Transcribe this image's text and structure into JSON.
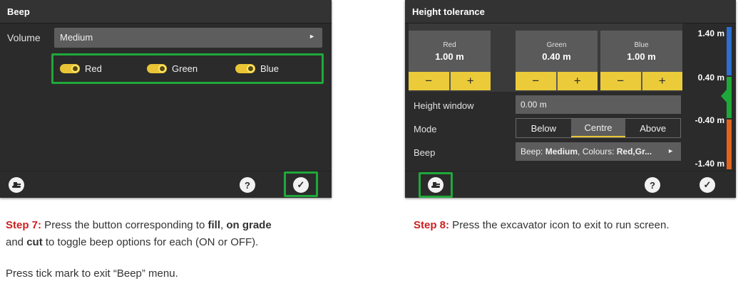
{
  "screen1": {
    "title": "Beep",
    "volume_label": "Volume",
    "volume_value": "Medium",
    "toggles": [
      {
        "label": "Red",
        "state": "on"
      },
      {
        "label": "Green",
        "state": "on"
      },
      {
        "label": "Blue",
        "state": "on"
      }
    ]
  },
  "screen2": {
    "title": "Height tolerance",
    "cards": [
      {
        "name": "Red",
        "value": "1.00 m",
        "minus": "−",
        "plus": "+"
      },
      {
        "name": "Green",
        "value": "0.40 m",
        "minus": "−",
        "plus": "+"
      },
      {
        "name": "Blue",
        "value": "1.00 m",
        "minus": "−",
        "plus": "+"
      }
    ],
    "height_window_label": "Height window",
    "height_window_value": "0.00 m",
    "mode_label": "Mode",
    "mode_options": [
      "Below",
      "Centre",
      "Above"
    ],
    "mode_selected": "Centre",
    "beep_label": "Beep",
    "beep_summary": {
      "prefix": "Beep: ",
      "volume": "Medium",
      "mid": ", Colours: ",
      "colours": "Red,Gr..."
    },
    "scale_labels": [
      "1.40 m",
      "0.40 m",
      "-0.40 m",
      "-1.40 m"
    ]
  },
  "icons": {
    "excavator": "excavator-icon",
    "help": "?",
    "confirm": "✓",
    "dropdown_arrow": "►"
  },
  "captions": {
    "step7": {
      "step": "Step 7:",
      "line1_a": " Press the button corresponding to ",
      "line1_b1": "fill",
      "line1_c": ", ",
      "line1_b2": "on grade",
      "line2_a": "and ",
      "line2_b": "cut",
      "line2_c": " to toggle beep options for each (ON or OFF).",
      "line3": "Press tick mark to exit “Beep” menu."
    },
    "step8": {
      "step": "Step 8:",
      "text": " Press the excavator icon to exit to run screen."
    }
  },
  "colors": {
    "highlight": "#1fa83a",
    "toggle_on": "#e9c535",
    "step_red": "#cc1f1f",
    "scale_blue": "#2d6fd3",
    "scale_green": "#1fa83a",
    "scale_orange": "#e0641f"
  }
}
